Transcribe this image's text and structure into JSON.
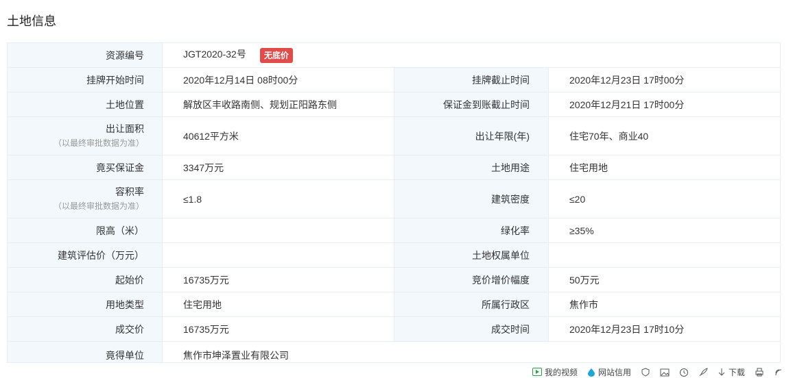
{
  "page": {
    "title": "土地信息"
  },
  "colors": {
    "label_bg": "#f3f8fc",
    "border": "#e8edf3",
    "badge_bg": "#e04b4b",
    "note": "#999999"
  },
  "resource": {
    "label": "资源编号",
    "value": "JGT2020-32号",
    "badge": "无底价"
  },
  "rows": {
    "listing_start": {
      "label": "挂牌开始时间",
      "value": "2020年12月14日 08时00分"
    },
    "listing_end": {
      "label": "挂牌截止时间",
      "value": "2020年12月23日 17时00分"
    },
    "location": {
      "label": "土地位置",
      "value": "解放区丰收路南侧、规划正阳路东侧"
    },
    "deposit_deadline": {
      "label": "保证金到账截止时间",
      "value": "2020年12月21日 17时00分"
    },
    "area": {
      "label": "出让面积",
      "note": "（以最终审批数据为准）",
      "value": "40612平方米"
    },
    "term": {
      "label": "出让年限(年)",
      "value": "住宅70年、商业40"
    },
    "deposit": {
      "label": "竟买保证金",
      "value": "3347万元"
    },
    "use": {
      "label": "土地用途",
      "value": "住宅用地"
    },
    "far": {
      "label": "容积率",
      "note": "（以最终审批数据为准）",
      "value": "≤1.8"
    },
    "density": {
      "label": "建筑密度",
      "value": "≤20"
    },
    "height": {
      "label": "限高（米）",
      "value": ""
    },
    "green": {
      "label": "绿化率",
      "value": "≥35%"
    },
    "building_value": {
      "label": "建筑评估价（万元）",
      "value": ""
    },
    "owner": {
      "label": "土地权属单位",
      "value": ""
    },
    "start_price": {
      "label": "起始价",
      "value": "16735万元"
    },
    "increment": {
      "label": "竞价增价幅度",
      "value": "50万元"
    },
    "land_type": {
      "label": "用地类型",
      "value": "住宅用地"
    },
    "district": {
      "label": "所属行政区",
      "value": "焦作市"
    },
    "deal_price": {
      "label": "成交价",
      "value": "16735万元"
    },
    "deal_time": {
      "label": "成交时间",
      "value": "2020年12月23日 17时10分"
    },
    "winner": {
      "label": "竟得单位",
      "value": "焦作市坤泽置业有限公司"
    }
  },
  "footer": {
    "my_video": "我的视频",
    "site_trust": "网站信用",
    "download": "下载",
    "icons": [
      "play-icon",
      "shield-drop-icon",
      "shield-icon",
      "image-icon",
      "clock-icon",
      "rocket-icon",
      "download-icon",
      "printer-icon",
      "cast-icon"
    ]
  }
}
